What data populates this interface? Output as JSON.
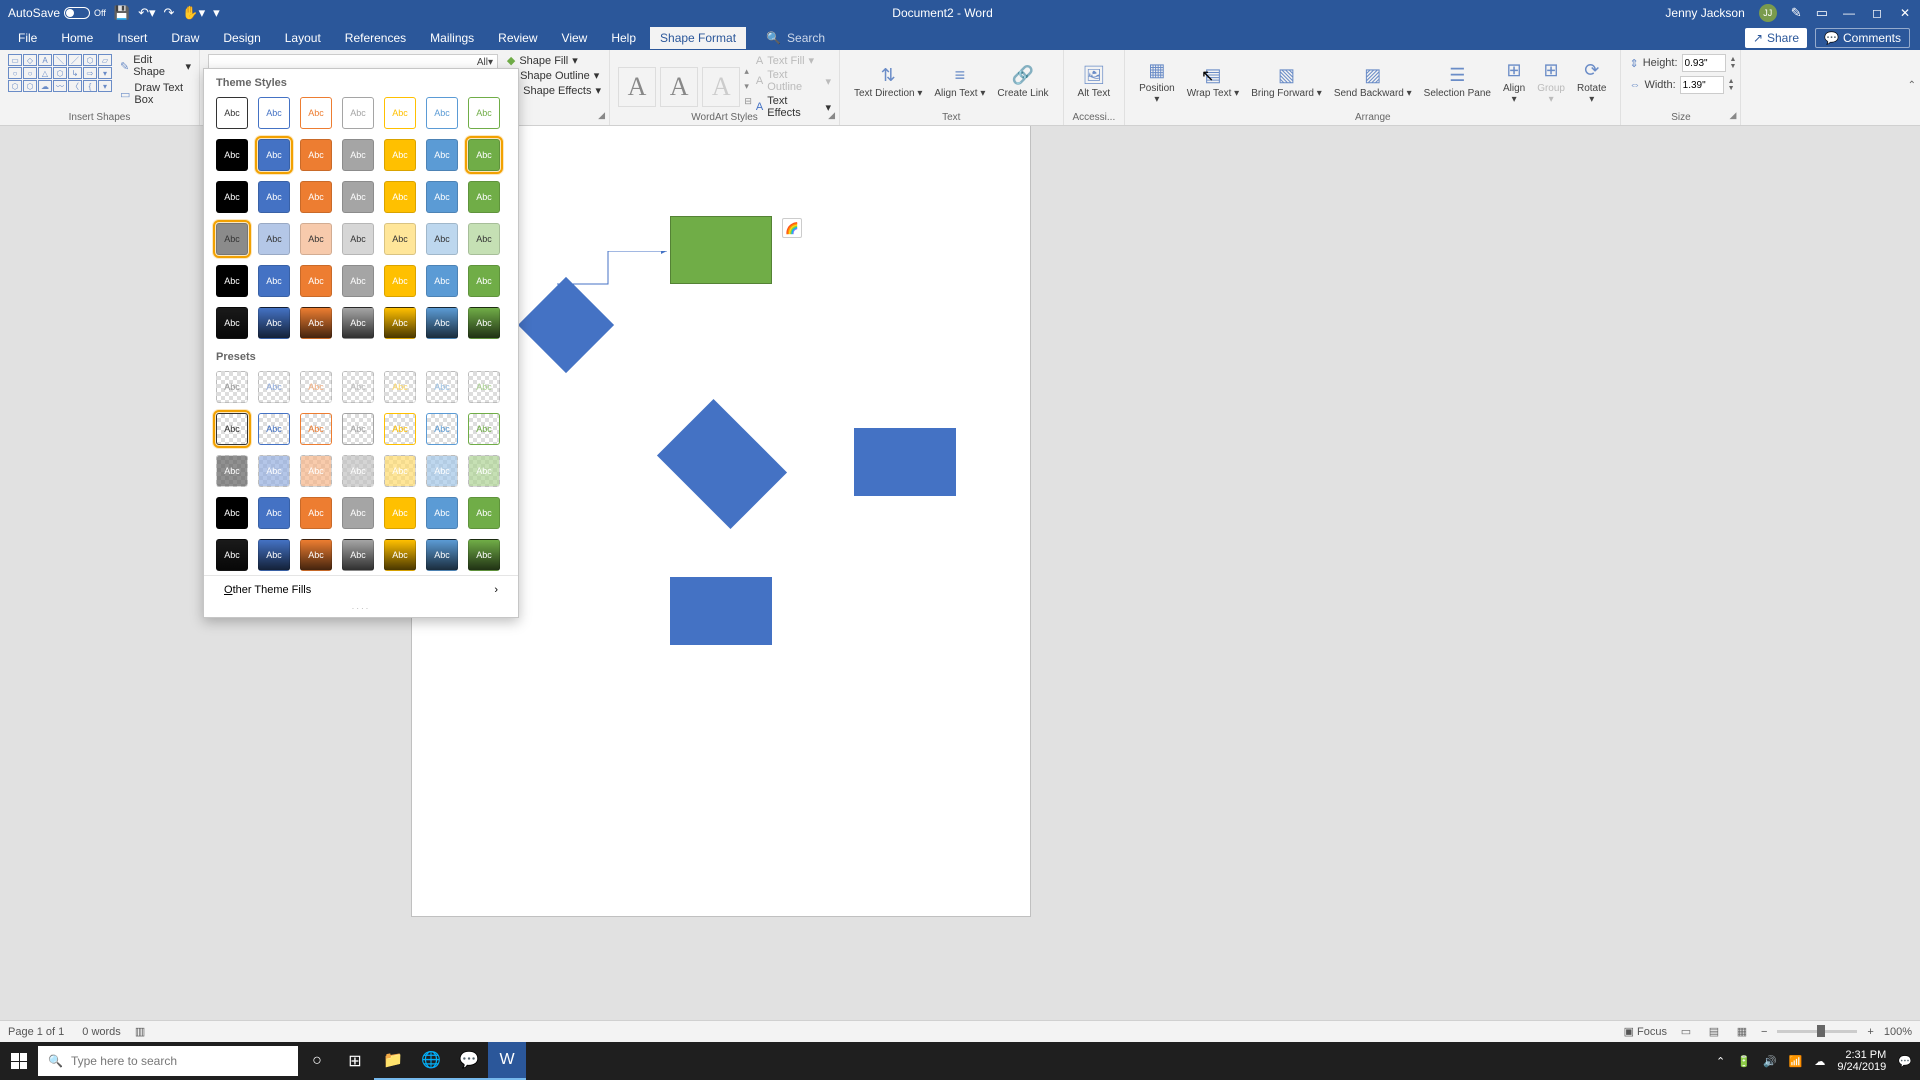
{
  "title_bar": {
    "autosave_label": "AutoSave",
    "autosave_state": "Off",
    "document_title": "Document2 - Word",
    "user_name": "Jenny Jackson",
    "user_initials": "JJ"
  },
  "menu": {
    "items": [
      "File",
      "Home",
      "Insert",
      "Draw",
      "Design",
      "Layout",
      "References",
      "Mailings",
      "Review",
      "View",
      "Help",
      "Shape Format"
    ],
    "active": "Shape Format",
    "search_placeholder": "Search",
    "share": "Share",
    "comments": "Comments"
  },
  "ribbon": {
    "insert_shapes": {
      "label": "Insert Shapes",
      "edit_shape": "Edit Shape",
      "draw_text_box": "Draw Text Box"
    },
    "shape_styles": {
      "dropdown_label": "All",
      "fill": "Shape Fill",
      "outline": "Shape Outline",
      "effects": "Shape Effects"
    },
    "wordart": {
      "label": "WordArt Styles",
      "text_fill": "Text Fill",
      "text_outline": "Text Outline",
      "text_effects": "Text Effects"
    },
    "text": {
      "label": "Text",
      "direction": "Text Direction",
      "align": "Align Text",
      "link": "Create Link"
    },
    "accessibility": {
      "label": "Accessi...",
      "alt": "Alt Text"
    },
    "arrange": {
      "label": "Arrange",
      "position": "Position",
      "wrap": "Wrap Text",
      "bring": "Bring Forward",
      "send": "Send Backward",
      "selection": "Selection Pane",
      "align": "Align",
      "group": "Group",
      "rotate": "Rotate"
    },
    "size": {
      "label": "Size",
      "height_label": "Height:",
      "height_value": "0.93\"",
      "width_label": "Width:",
      "width_value": "1.39\""
    }
  },
  "dropdown": {
    "theme_title": "Theme Styles",
    "presets_title": "Presets",
    "other": "Other Theme Fills",
    "swatch_text": "Abc",
    "theme_rows": [
      {
        "base": "outline",
        "colors": [
          "#ffffff",
          "#ffffff",
          "#ffffff",
          "#ffffff",
          "#ffffff",
          "#ffffff",
          "#ffffff"
        ],
        "text": [
          "#333",
          "#4472c4",
          "#ed7d31",
          "#a5a5a5",
          "#ffc000",
          "#5b9bd5",
          "#70ad47"
        ],
        "border": [
          "#333",
          "#4472c4",
          "#ed7d31",
          "#a5a5a5",
          "#ffc000",
          "#5b9bd5",
          "#70ad47"
        ]
      },
      {
        "base": "solid",
        "colors": [
          "#000000",
          "#4472c4",
          "#ed7d31",
          "#a5a5a5",
          "#ffc000",
          "#5b9bd5",
          "#70ad47"
        ],
        "text": [
          "#fff",
          "#fff",
          "#fff",
          "#fff",
          "#fff",
          "#fff",
          "#fff"
        ],
        "selected": [
          1,
          6
        ]
      },
      {
        "base": "solid",
        "colors": [
          "#000000",
          "#4472c4",
          "#ed7d31",
          "#a5a5a5",
          "#ffc000",
          "#5b9bd5",
          "#70ad47"
        ],
        "text": [
          "#fff",
          "#fff",
          "#fff",
          "#fff",
          "#fff",
          "#fff",
          "#fff"
        ]
      },
      {
        "base": "solid",
        "colors": [
          "#8b8b8b",
          "#b4c7e7",
          "#f7caac",
          "#d6d6d6",
          "#ffe699",
          "#bdd7ee",
          "#c5e0b4"
        ],
        "text": [
          "#333",
          "#333",
          "#333",
          "#333",
          "#333",
          "#333",
          "#333"
        ],
        "selected": [
          0
        ]
      },
      {
        "base": "solid",
        "colors": [
          "#000000",
          "#4472c4",
          "#ed7d31",
          "#a5a5a5",
          "#ffc000",
          "#5b9bd5",
          "#70ad47"
        ],
        "text": [
          "#fff",
          "#fff",
          "#fff",
          "#fff",
          "#fff",
          "#fff",
          "#fff"
        ]
      },
      {
        "base": "gradient",
        "colors": [
          "#1a1a1a",
          "#4472c4",
          "#ed7d31",
          "#a5a5a5",
          "#ffc000",
          "#5b9bd5",
          "#70ad47"
        ],
        "text": [
          "#fff",
          "#fff",
          "#fff",
          "#fff",
          "#fff",
          "#fff",
          "#fff"
        ]
      }
    ],
    "preset_rows": [
      {
        "checker": true,
        "text": [
          "#999",
          "#8faadc",
          "#f4b183",
          "#bfbfbf",
          "#ffd966",
          "#9dc3e6",
          "#a9d18e"
        ]
      },
      {
        "checker": true,
        "text": [
          "#333",
          "#4472c4",
          "#ed7d31",
          "#a5a5a5",
          "#ffc000",
          "#5b9bd5",
          "#70ad47"
        ],
        "border": [
          "#333",
          "#4472c4",
          "#ed7d31",
          "#a5a5a5",
          "#ffc000",
          "#5b9bd5",
          "#70ad47"
        ],
        "selected": [
          0
        ]
      },
      {
        "checker": true,
        "text": [
          "#fff",
          "#fff",
          "#fff",
          "#fff",
          "#fff",
          "#fff",
          "#fff"
        ],
        "overlay": [
          "#595959",
          "#8faadc",
          "#f4b183",
          "#bfbfbf",
          "#ffd966",
          "#9dc3e6",
          "#a9d18e"
        ]
      },
      {
        "base": "solid",
        "colors": [
          "#000000",
          "#4472c4",
          "#ed7d31",
          "#a5a5a5",
          "#ffc000",
          "#5b9bd5",
          "#70ad47"
        ],
        "text": [
          "#fff",
          "#fff",
          "#fff",
          "#fff",
          "#fff",
          "#fff",
          "#fff"
        ]
      },
      {
        "base": "gradient",
        "colors": [
          "#1a1a1a",
          "#4472c4",
          "#ed7d31",
          "#a5a5a5",
          "#ffc000",
          "#5b9bd5",
          "#70ad47"
        ],
        "text": [
          "#fff",
          "#fff",
          "#fff",
          "#fff",
          "#fff",
          "#fff",
          "#fff"
        ]
      }
    ]
  },
  "status": {
    "page": "Page 1 of 1",
    "words": "0 words",
    "focus": "Focus",
    "zoom": "100%"
  },
  "taskbar": {
    "search_placeholder": "Type here to search",
    "time": "2:31 PM",
    "date": "9/24/2019"
  }
}
